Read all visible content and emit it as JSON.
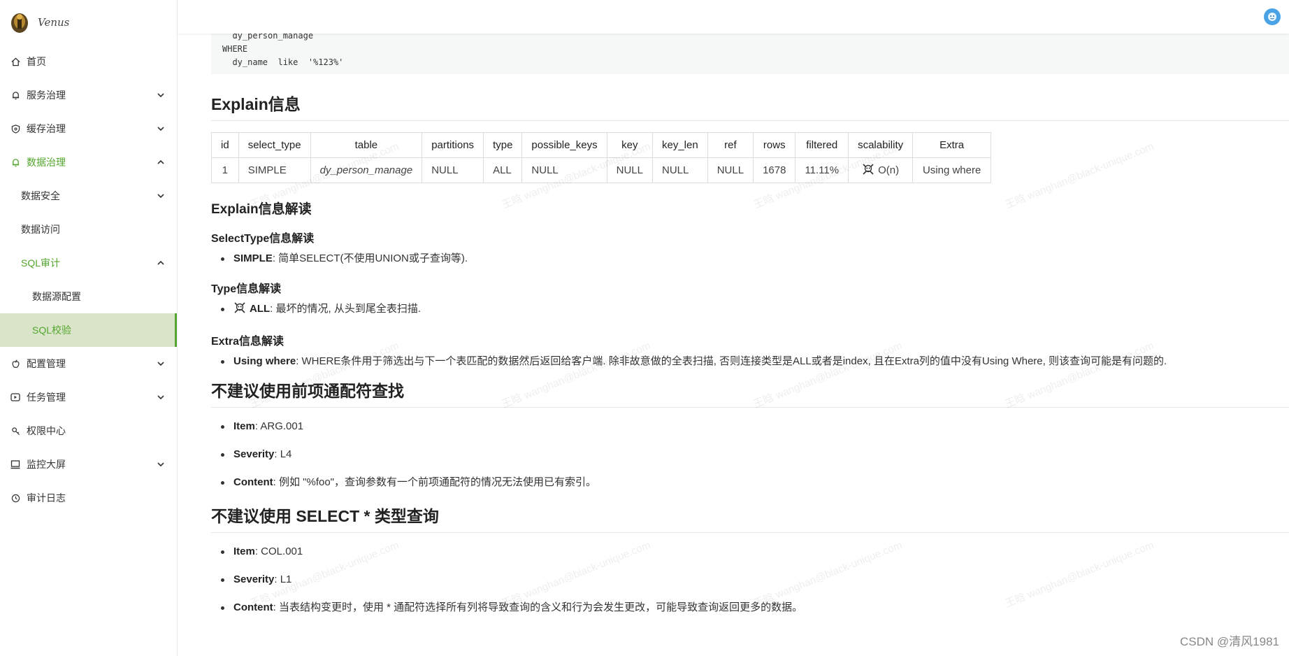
{
  "app": {
    "logo_text": "Venus"
  },
  "sidebar": {
    "items": [
      {
        "label": "首页",
        "icon": "home-icon"
      },
      {
        "label": "服务治理",
        "icon": "bell-icon"
      },
      {
        "label": "缓存治理",
        "icon": "shield-icon"
      },
      {
        "label": "数据治理",
        "icon": "bell-icon"
      },
      {
        "label": "数据安全"
      },
      {
        "label": "数据访问"
      },
      {
        "label": "SQL审计"
      },
      {
        "label": "数据源配置"
      },
      {
        "label": "SQL校验"
      },
      {
        "label": "配置管理",
        "icon": "apple-icon"
      },
      {
        "label": "任务管理",
        "icon": "play-icon"
      },
      {
        "label": "权限中心",
        "icon": "key-icon"
      },
      {
        "label": "监控大屏",
        "icon": "monitor-icon"
      },
      {
        "label": "审计日志",
        "icon": "clock-icon"
      }
    ]
  },
  "code": {
    "lines": [
      "  dy_person_manage",
      "WHERE",
      "  dy_name  like  '%123%'"
    ]
  },
  "explain": {
    "title": "Explain信息",
    "headers": [
      "id",
      "select_type",
      "table",
      "partitions",
      "type",
      "possible_keys",
      "key",
      "key_len",
      "ref",
      "rows",
      "filtered",
      "scalability",
      "Extra"
    ],
    "row": [
      "1",
      "SIMPLE",
      "dy_person_manage",
      "NULL",
      "ALL",
      "NULL",
      "NULL",
      "NULL",
      "NULL",
      "1678",
      "11.11%",
      "O(n)",
      "Using where"
    ]
  },
  "interpret": {
    "title": "Explain信息解读",
    "select_type": {
      "title": "SelectType信息解读",
      "key": "SIMPLE",
      "text": ": 简单SELECT(不使用UNION或子查询等)."
    },
    "type": {
      "title": "Type信息解读",
      "key": "ALL",
      "text": ": 最坏的情况, 从头到尾全表扫描."
    },
    "extra": {
      "title": "Extra信息解读",
      "key": "Using where",
      "text": ": WHERE条件用于筛选出与下一个表匹配的数据然后返回给客户端. 除非故意做的全表扫描, 否则连接类型是ALL或者是index, 且在Extra列的值中没有Using Where, 则该查询可能是有问题的."
    }
  },
  "rule1": {
    "title": "不建议使用前项通配符查找",
    "item_label": "Item",
    "item": ": ARG.001",
    "severity_label": "Severity",
    "severity": ": L4",
    "content_label": "Content",
    "content": ": 例如 \"%foo\"，查询参数有一个前项通配符的情况无法使用已有索引。"
  },
  "rule2": {
    "title": "不建议使用 SELECT * 类型查询",
    "item_label": "Item",
    "item": ": COL.001",
    "severity_label": "Severity",
    "severity": ": L1",
    "content_label": "Content",
    "content": ": 当表结构变更时，使用 * 通配符选择所有列将导致查询的含义和行为会发生更改，可能导致查询返回更多的数据。"
  },
  "watermark": {
    "text": "王晗 wanghan@black-unique.com"
  },
  "footer": {
    "csdn": "CSDN @清风1981"
  },
  "colors": {
    "accent": "#52a52e",
    "active_bg": "#d9e4c8"
  }
}
